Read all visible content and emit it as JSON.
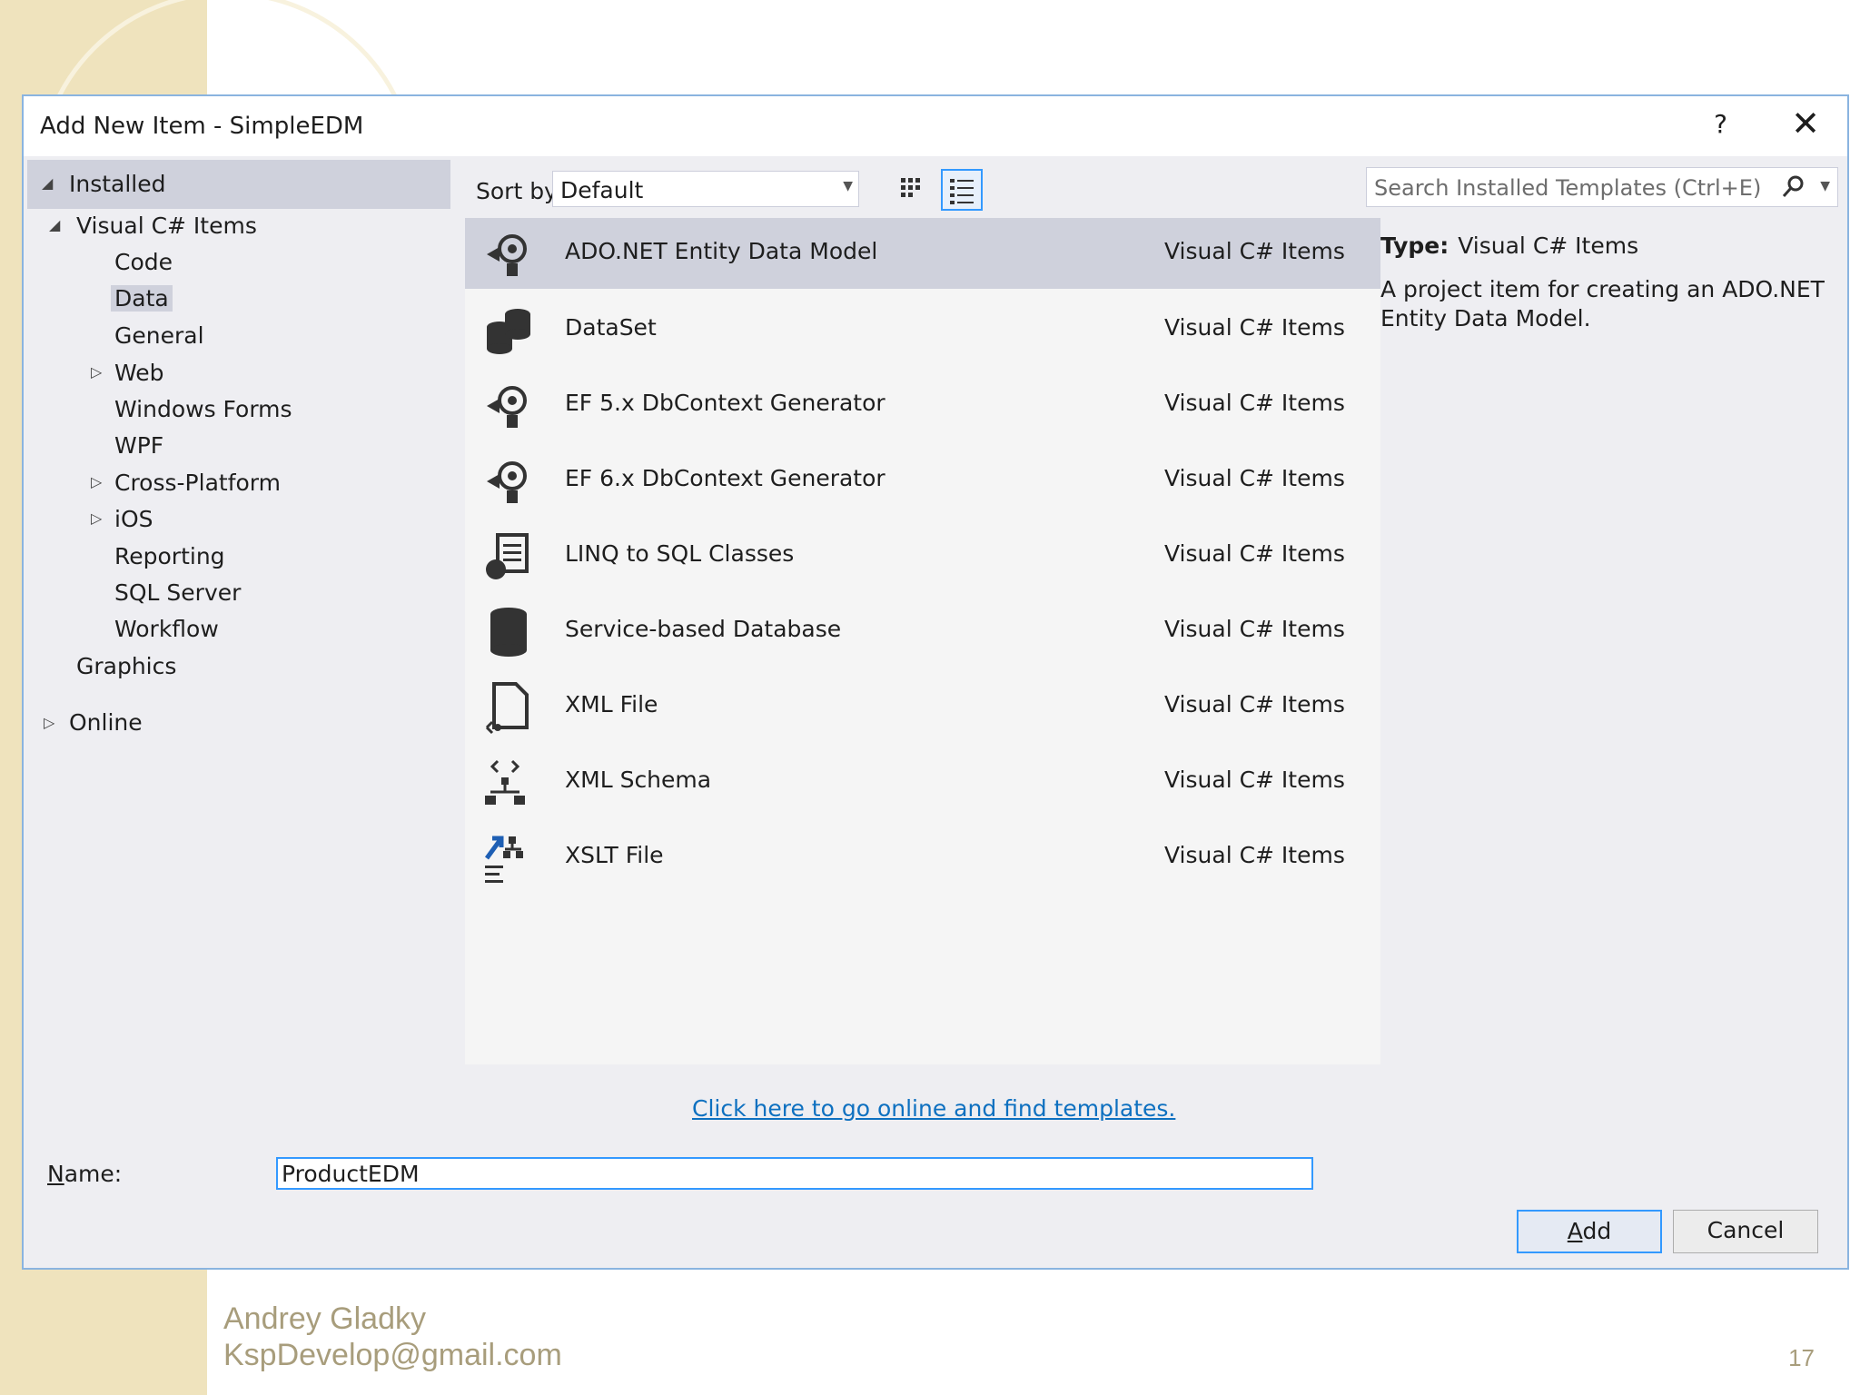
{
  "slide": {
    "author_name": "Andrey Gladky",
    "author_email": "KspDevelop@gmail.com",
    "page_number": "17"
  },
  "dialog": {
    "title": "Add New Item - SimpleEDM",
    "help_label": "?",
    "close_label": "✕"
  },
  "tree": {
    "installed": "Installed",
    "visual_csharp": "Visual C# Items",
    "children": [
      "Code",
      "Data",
      "General",
      "Web",
      "Windows Forms",
      "WPF",
      "Cross-Platform",
      "iOS",
      "Reporting",
      "SQL Server",
      "Workflow"
    ],
    "graphics": "Graphics",
    "online": "Online",
    "selected": "Data"
  },
  "toolbar": {
    "sort_label": "Sort by:",
    "sort_value": "Default",
    "view_mode": "list"
  },
  "search": {
    "placeholder": "Search Installed Templates (Ctrl+E)"
  },
  "templates": [
    {
      "name": "ADO.NET Entity Data Model",
      "category": "Visual C# Items",
      "icon": "entity-model-icon",
      "selected": true
    },
    {
      "name": "DataSet",
      "category": "Visual C# Items",
      "icon": "dataset-icon"
    },
    {
      "name": "EF 5.x DbContext Generator",
      "category": "Visual C# Items",
      "icon": "dbcontext-generator-icon"
    },
    {
      "name": "EF 6.x DbContext Generator",
      "category": "Visual C# Items",
      "icon": "dbcontext-generator-icon"
    },
    {
      "name": "LINQ to SQL Classes",
      "category": "Visual C# Items",
      "icon": "linq-to-sql-icon"
    },
    {
      "name": "Service-based Database",
      "category": "Visual C# Items",
      "icon": "database-icon"
    },
    {
      "name": "XML File",
      "category": "Visual C# Items",
      "icon": "xml-file-icon"
    },
    {
      "name": "XML Schema",
      "category": "Visual C# Items",
      "icon": "xml-schema-icon"
    },
    {
      "name": "XSLT File",
      "category": "Visual C# Items",
      "icon": "xslt-file-icon"
    }
  ],
  "details": {
    "type_label": "Type:",
    "type_value": "Visual C# Items",
    "description": "A project item for creating an ADO.NET Entity Data Model."
  },
  "online_link": "Click here to go online and find templates.",
  "name_field": {
    "label_underlined": "N",
    "label_rest": "ame:",
    "value": "ProductEDM"
  },
  "buttons": {
    "add_underlined": "A",
    "add_rest": "dd",
    "cancel": "Cancel"
  },
  "colors": {
    "accent": "#3399ff",
    "selection": "#cfd1dc",
    "link": "#0e70c0"
  }
}
